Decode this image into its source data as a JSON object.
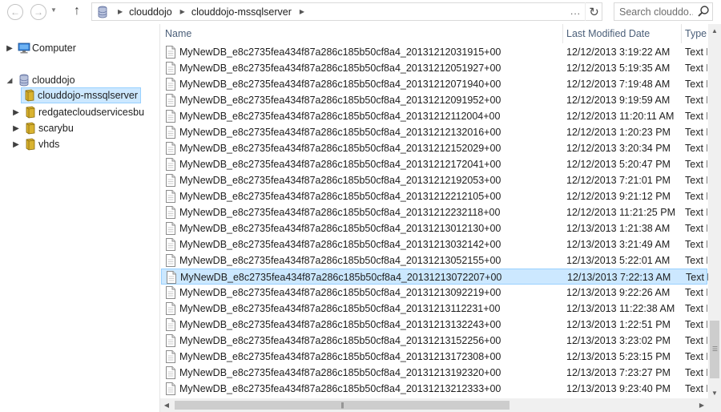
{
  "address": {
    "crumbs": [
      "clouddojo",
      "clouddojo-mssqlserver"
    ],
    "overflow": "..."
  },
  "search": {
    "placeholder": "Search clouddo..."
  },
  "navigation": {
    "tree": [
      {
        "label": "Computer",
        "icon": "computer-icon",
        "expanded": false
      },
      {
        "label": "clouddojo",
        "icon": "storage-account-icon",
        "expanded": true
      },
      {
        "label": "clouddojo-mssqlserver",
        "icon": "container-icon",
        "selected": true
      },
      {
        "label": "redgatecloudservicesbu",
        "icon": "container-icon",
        "expanded": false
      },
      {
        "label": "scarybu",
        "icon": "container-icon",
        "expanded": false
      },
      {
        "label": "vhds",
        "icon": "container-icon",
        "expanded": false
      }
    ]
  },
  "columns": {
    "name": "Name",
    "modified": "Last Modified Date",
    "type": "Type"
  },
  "files": [
    {
      "name": "MyNewDB_e8c2735fea434f87a286c185b50cf8a4_20131212031915+00",
      "modified": "12/12/2013 3:19:22 AM",
      "type": "Text Document"
    },
    {
      "name": "MyNewDB_e8c2735fea434f87a286c185b50cf8a4_20131212051927+00",
      "modified": "12/12/2013 5:19:35 AM",
      "type": "Text Document"
    },
    {
      "name": "MyNewDB_e8c2735fea434f87a286c185b50cf8a4_20131212071940+00",
      "modified": "12/12/2013 7:19:48 AM",
      "type": "Text Document"
    },
    {
      "name": "MyNewDB_e8c2735fea434f87a286c185b50cf8a4_20131212091952+00",
      "modified": "12/12/2013 9:19:59 AM",
      "type": "Text Document"
    },
    {
      "name": "MyNewDB_e8c2735fea434f87a286c185b50cf8a4_20131212112004+00",
      "modified": "12/12/2013 11:20:11 AM",
      "type": "Text Document"
    },
    {
      "name": "MyNewDB_e8c2735fea434f87a286c185b50cf8a4_20131212132016+00",
      "modified": "12/12/2013 1:20:23 PM",
      "type": "Text Document"
    },
    {
      "name": "MyNewDB_e8c2735fea434f87a286c185b50cf8a4_20131212152029+00",
      "modified": "12/12/2013 3:20:34 PM",
      "type": "Text Document"
    },
    {
      "name": "MyNewDB_e8c2735fea434f87a286c185b50cf8a4_20131212172041+00",
      "modified": "12/12/2013 5:20:47 PM",
      "type": "Text Document"
    },
    {
      "name": "MyNewDB_e8c2735fea434f87a286c185b50cf8a4_20131212192053+00",
      "modified": "12/12/2013 7:21:01 PM",
      "type": "Text Document"
    },
    {
      "name": "MyNewDB_e8c2735fea434f87a286c185b50cf8a4_20131212212105+00",
      "modified": "12/12/2013 9:21:12 PM",
      "type": "Text Document"
    },
    {
      "name": "MyNewDB_e8c2735fea434f87a286c185b50cf8a4_20131212232118+00",
      "modified": "12/12/2013 11:21:25 PM",
      "type": "Text Document"
    },
    {
      "name": "MyNewDB_e8c2735fea434f87a286c185b50cf8a4_20131213012130+00",
      "modified": "12/13/2013 1:21:38 AM",
      "type": "Text Document"
    },
    {
      "name": "MyNewDB_e8c2735fea434f87a286c185b50cf8a4_20131213032142+00",
      "modified": "12/13/2013 3:21:49 AM",
      "type": "Text Document"
    },
    {
      "name": "MyNewDB_e8c2735fea434f87a286c185b50cf8a4_20131213052155+00",
      "modified": "12/13/2013 5:22:01 AM",
      "type": "Text Document"
    },
    {
      "name": "MyNewDB_e8c2735fea434f87a286c185b50cf8a4_20131213072207+00",
      "modified": "12/13/2013 7:22:13 AM",
      "type": "Text Document",
      "selected": true
    },
    {
      "name": "MyNewDB_e8c2735fea434f87a286c185b50cf8a4_20131213092219+00",
      "modified": "12/13/2013 9:22:26 AM",
      "type": "Text Document"
    },
    {
      "name": "MyNewDB_e8c2735fea434f87a286c185b50cf8a4_20131213112231+00",
      "modified": "12/13/2013 11:22:38 AM",
      "type": "Text Document"
    },
    {
      "name": "MyNewDB_e8c2735fea434f87a286c185b50cf8a4_20131213132243+00",
      "modified": "12/13/2013 1:22:51 PM",
      "type": "Text Document"
    },
    {
      "name": "MyNewDB_e8c2735fea434f87a286c185b50cf8a4_20131213152256+00",
      "modified": "12/13/2013 3:23:02 PM",
      "type": "Text Document"
    },
    {
      "name": "MyNewDB_e8c2735fea434f87a286c185b50cf8a4_20131213172308+00",
      "modified": "12/13/2013 5:23:15 PM",
      "type": "Text Document"
    },
    {
      "name": "MyNewDB_e8c2735fea434f87a286c185b50cf8a4_20131213192320+00",
      "modified": "12/13/2013 7:23:27 PM",
      "type": "Text Document"
    },
    {
      "name": "MyNewDB_e8c2735fea434f87a286c185b50cf8a4_20131213212333+00",
      "modified": "12/13/2013 9:23:40 PM",
      "type": "Text Document"
    }
  ],
  "colors": {
    "selection_fill": "#cce8ff",
    "selection_border": "#99d1ff",
    "header_text": "#4c607a",
    "container_icon": "#c9a21f"
  }
}
